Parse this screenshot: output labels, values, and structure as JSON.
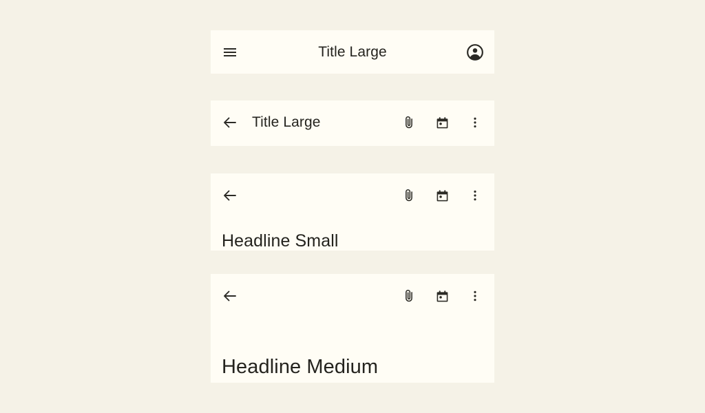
{
  "theme": {
    "page_background": "#f5f2e7",
    "surface": "#fffdf5",
    "on_surface": "#24231e",
    "icon_color": "#2b2a25"
  },
  "app_bars": [
    {
      "variant": "center-aligned",
      "leading_icon": "menu-icon",
      "title": "Title Large",
      "trailing_icons": [
        "account-circle-icon"
      ]
    },
    {
      "variant": "small",
      "leading_icon": "back-arrow-icon",
      "title": "Title Large",
      "trailing_icons": [
        "attachment-icon",
        "calendar-today-icon",
        "more-vert-icon"
      ]
    },
    {
      "variant": "medium",
      "leading_icon": "back-arrow-icon",
      "headline": "Headline Small",
      "trailing_icons": [
        "attachment-icon",
        "calendar-today-icon",
        "more-vert-icon"
      ]
    },
    {
      "variant": "large",
      "leading_icon": "back-arrow-icon",
      "headline": "Headline Medium",
      "trailing_icons": [
        "attachment-icon",
        "calendar-today-icon",
        "more-vert-icon"
      ]
    }
  ]
}
